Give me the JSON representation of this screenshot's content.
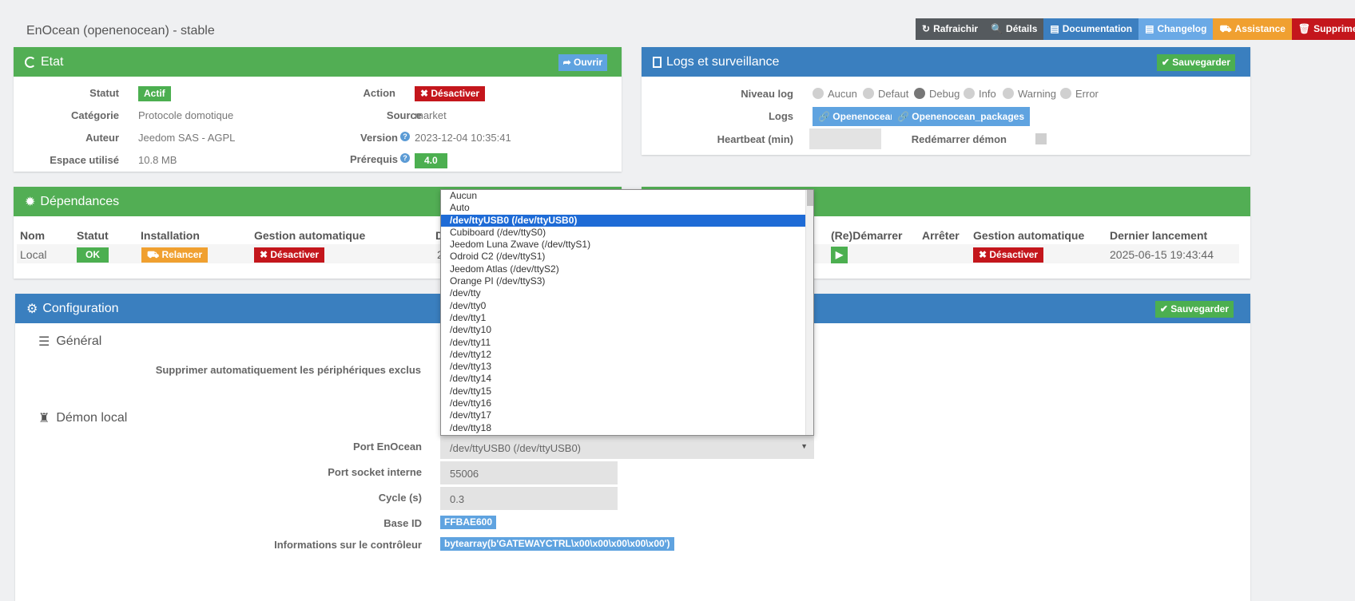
{
  "title": "EnOcean (openenocean) - stable",
  "topbar": [
    {
      "icon": "↻",
      "label": "Rafraichir",
      "cls": "b-dark"
    },
    {
      "icon": "🔍",
      "label": "Détails",
      "cls": "b-dark2"
    },
    {
      "icon": "▤",
      "label": "Documentation",
      "cls": "b-blue"
    },
    {
      "icon": "▤",
      "label": "Changelog",
      "cls": "b-lblue"
    },
    {
      "icon": "⛟",
      "label": "Assistance",
      "cls": "b-orange"
    },
    {
      "icon": "🗑",
      "label": "Supprimer",
      "cls": "b-red"
    }
  ],
  "etat": {
    "header": "Etat",
    "open_label": "Ouvrir",
    "statut_label": "Statut",
    "statut_value": "Actif",
    "categorie_label": "Catégorie",
    "categorie_value": "Protocole domotique",
    "auteur_label": "Auteur",
    "auteur_value": "Jeedom SAS - AGPL",
    "espace_label": "Espace utilisé",
    "espace_value": "10.8 MB",
    "action_label": "Action",
    "action_value": "Désactiver",
    "source_label": "Source",
    "source_value": "market",
    "version_label": "Version",
    "version_value": "2023-12-04 10:35:41",
    "prereq_label": "Prérequis",
    "prereq_value": "4.0"
  },
  "logs": {
    "header": "Logs et surveillance",
    "save_label": "Sauvegarder",
    "niveau_label": "Niveau log",
    "levels": [
      "Aucun",
      "Defaut",
      "Debug",
      "Info",
      "Warning",
      "Error"
    ],
    "selected_level": "Debug",
    "logs_label": "Logs",
    "log_buttons": [
      "Openenocean",
      "Openenocean_packages"
    ],
    "heartbeat_label": "Heartbeat (min)",
    "restart_label": "Redémarrer démon"
  },
  "deps": {
    "header": "Dépendances",
    "cols": [
      "Nom",
      "Statut",
      "Installation",
      "Gestion automatique",
      "D"
    ],
    "row": {
      "nom": "Local",
      "statut": "OK",
      "installation": "Relancer",
      "gestion": "Désactiver",
      "d": "2"
    }
  },
  "demon": {
    "cols": [
      "(Re)Démarrer",
      "Arrêter",
      "Gestion automatique",
      "Dernier lancement"
    ],
    "gestion": "Désactiver",
    "dernier": "2025-06-15 19:43:44"
  },
  "config": {
    "header": "Configuration",
    "save_label": "Sauvegarder",
    "general_title": "Général",
    "supprimer_label": "Supprimer automatiquement les périphériques exclus",
    "demon_title": "Démon local",
    "port_label": "Port EnOcean",
    "port_value": "/dev/ttyUSB0 (/dev/ttyUSB0)",
    "socket_label": "Port socket interne",
    "socket_value": "55006",
    "cycle_label": "Cycle (s)",
    "cycle_value": "0.3",
    "baseid_label": "Base ID",
    "baseid_value": "FFBAE600",
    "info_label": "Informations sur le contrôleur",
    "info_value": "bytearray(b'GATEWAYCTRL\\x00\\x00\\x00\\x00\\x00')"
  },
  "dropdown": {
    "options": [
      "Aucun",
      "Auto",
      "/dev/ttyUSB0 (/dev/ttyUSB0)",
      "Cubiboard (/dev/ttyS0)",
      "Jeedom Luna Zwave (/dev/ttyS1)",
      "Odroid C2 (/dev/ttyS1)",
      "Jeedom Atlas (/dev/ttyS2)",
      "Orange PI (/dev/ttyS3)",
      "/dev/tty",
      "/dev/tty0",
      "/dev/tty1",
      "/dev/tty10",
      "/dev/tty11",
      "/dev/tty12",
      "/dev/tty13",
      "/dev/tty14",
      "/dev/tty15",
      "/dev/tty16",
      "/dev/tty17",
      "/dev/tty18"
    ],
    "selected": "/dev/ttyUSB0 (/dev/ttyUSB0)"
  }
}
